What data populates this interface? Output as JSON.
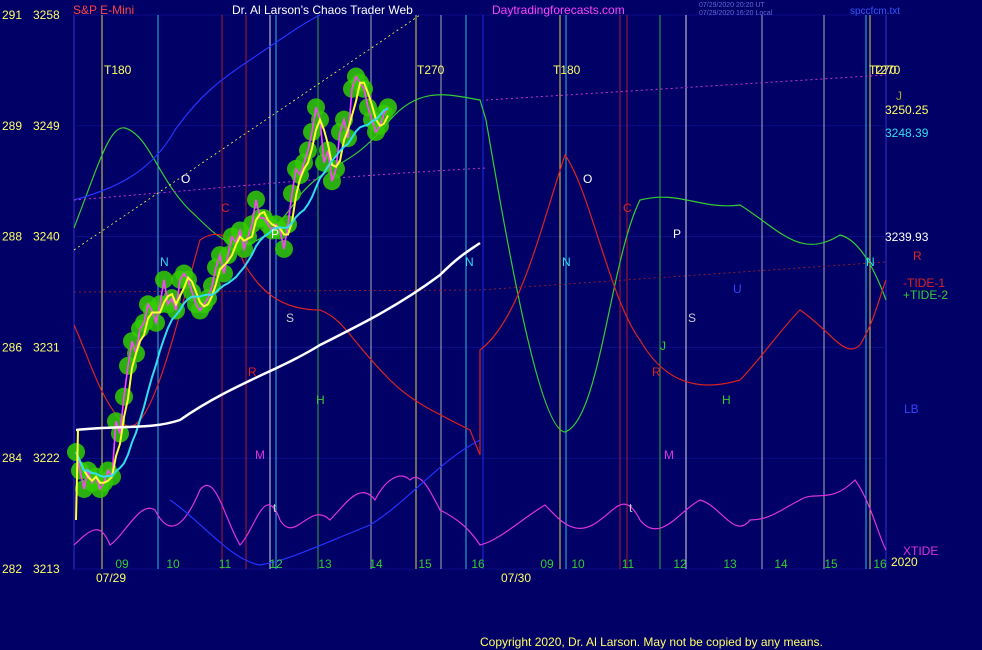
{
  "header": {
    "symbol": "S&P E-Mini",
    "site": "Dr. Al Larson's Chaos Trader Web",
    "url": "Daytradingforecasts.com",
    "time_lines": [
      "07/29/2020 20:20 UT",
      "07/29/2020 16:20 Local"
    ],
    "file": "spccfcm.txt"
  },
  "footer": {
    "copyright": "Copyright 2020, Dr. Al Larson. May not be copied by any means."
  },
  "colors": {
    "background": "#000066",
    "price_bars": "#ff44ff",
    "price_glow": "#33cc00",
    "ma_fast": "#ffff33",
    "ma_mid": "#33ddee",
    "ma_slow": "#ffffff",
    "tide1": "#dd2222",
    "tide2": "#33cc33",
    "xtide": "#dd33dd",
    "lb": "#2233ff"
  },
  "chart_data": {
    "type": "line",
    "title": "S&P E-Mini",
    "x_tick_labels": [
      "09",
      "10",
      "11",
      "12",
      "13",
      "14",
      "15",
      "16",
      "09",
      "10",
      "11",
      "12",
      "13",
      "14",
      "15",
      "16"
    ],
    "date_labels": [
      "07/29",
      "07/30"
    ],
    "year_label": "2020",
    "ylim": [
      3213,
      3258
    ],
    "y_ticks": [
      {
        "index": 291,
        "price": 3258
      },
      {
        "index": 289,
        "price": 3249
      },
      {
        "index": 288,
        "price": 3240
      },
      {
        "index": 286,
        "price": 3231
      },
      {
        "index": 284,
        "price": 3222
      },
      {
        "index": 282,
        "price": 3213
      }
    ],
    "right_labels": [
      {
        "text": "T270",
        "color": "#ffff66"
      },
      {
        "text": "J",
        "color": "#aaaa33"
      },
      {
        "text": "3250.25",
        "color": "#ffff66"
      },
      {
        "text": "3248.39",
        "color": "#33ddee"
      },
      {
        "text": "3239.93",
        "color": "#ffffff"
      },
      {
        "text": "R",
        "color": "#dd2222"
      },
      {
        "text": "-TIDE-1",
        "color": "#dd2222"
      },
      {
        "text": "+TIDE-2",
        "color": "#33cc33"
      },
      {
        "text": "LB",
        "color": "#3344ff"
      },
      {
        "text": "XTIDE",
        "color": "#dd33dd"
      }
    ],
    "cycle_labels": [
      {
        "text": "T180",
        "color": "#ffff66"
      },
      {
        "text": "T270",
        "color": "#ffff66"
      },
      {
        "text": "T180",
        "color": "#ffff66"
      },
      {
        "text": "T270",
        "color": "#ffff66"
      }
    ],
    "planet_labels": [
      {
        "text": "O",
        "color": "#ffffff"
      },
      {
        "text": "C",
        "color": "#dd2222"
      },
      {
        "text": "P",
        "color": "#ffffff"
      },
      {
        "text": "N",
        "color": "#33ddee"
      },
      {
        "text": "S",
        "color": "#cccccc"
      },
      {
        "text": "R",
        "color": "#dd2222"
      },
      {
        "text": "M",
        "color": "#dd33dd"
      },
      {
        "text": "H",
        "color": "#33cc33"
      },
      {
        "text": "t",
        "color": "#cccccc"
      },
      {
        "text": "N",
        "color": "#33ddee"
      },
      {
        "text": "N",
        "color": "#33ddee"
      },
      {
        "text": "O",
        "color": "#ffffff"
      },
      {
        "text": "C",
        "color": "#dd2222"
      },
      {
        "text": "P",
        "color": "#ffffff"
      },
      {
        "text": "U",
        "color": "#3344ff"
      },
      {
        "text": "S",
        "color": "#cccccc"
      },
      {
        "text": "J",
        "color": "#33cc33"
      },
      {
        "text": "R",
        "color": "#dd2222"
      },
      {
        "text": "H",
        "color": "#33cc33"
      },
      {
        "text": "M",
        "color": "#dd33dd"
      },
      {
        "text": "t",
        "color": "#cccccc"
      },
      {
        "text": "N",
        "color": "#33ddee"
      }
    ],
    "series": [
      {
        "name": "S&P E-Mini",
        "x": [
          0,
          4,
          8,
          12,
          16,
          20,
          24,
          28,
          32,
          36,
          40,
          44,
          48,
          52,
          56,
          60,
          64,
          68,
          72,
          76,
          80,
          84,
          88,
          92,
          96,
          100,
          104,
          108,
          112,
          116,
          120,
          124,
          128,
          132,
          136,
          140,
          144,
          148,
          152,
          156,
          160,
          164,
          168,
          172,
          176,
          180,
          184,
          188,
          192,
          196,
          200,
          204,
          208,
          212,
          216,
          220,
          224,
          228,
          232,
          236,
          240,
          244,
          248,
          252,
          256,
          260,
          264,
          268,
          272,
          276,
          280,
          284,
          288,
          292,
          296,
          300,
          304,
          308,
          312,
          316,
          320,
          324,
          328,
          332,
          336,
          340,
          344,
          348,
          352,
          356,
          360,
          364,
          368,
          372,
          376,
          380,
          384,
          388,
          392,
          396,
          400,
          404,
          408
        ],
        "values": [
          3222.5,
          3221.0,
          3219.5,
          3221.0,
          3220.0,
          3220.5,
          3219.5,
          3220.0,
          3221.0,
          3220.5,
          3225.0,
          3224.0,
          3227.0,
          3229.5,
          3231.5,
          3230.5,
          3232.5,
          3233.0,
          3234.5,
          3234.0,
          3233.0,
          3234.5,
          3236.5,
          3234.5,
          3235.0,
          3234.0,
          3236.5,
          3237.0,
          3236.5,
          3235.5,
          3234.5,
          3234.0,
          3234.5,
          3235.0,
          3236.0,
          3237.5,
          3238.5,
          3237.0,
          3238.5,
          3240.0,
          3239.5,
          3240.5,
          3239.0,
          3240.0,
          3241.0,
          3243.0,
          3241.5,
          3241.5,
          3241.0,
          3240.5,
          3241.0,
          3240.5,
          3239.0,
          3241.0,
          3243.5,
          3245.5,
          3245.0,
          3246.0,
          3247.0,
          3248.5,
          3250.5,
          3249.5,
          3246.0,
          3247.0,
          3244.5,
          3245.5,
          3248.5,
          3249.5,
          3248.0,
          3252.0,
          3253.0,
          3252.5,
          3252.0,
          3250.5,
          3249.5,
          3248.5,
          3249.0,
          3250.0,
          3250.5,
          3250.25,
          3250.25,
          3250.25,
          3250.25,
          3250.25,
          3250.25,
          3250.25,
          3250.25,
          3250.25,
          3250.25,
          3250.25,
          3250.25,
          3250.25,
          3250.25,
          3250.25,
          3250.25,
          3250.25,
          3250.25,
          3250.25,
          3250.25,
          3250.25,
          3250.25,
          3250.25,
          3250.25
        ]
      }
    ]
  }
}
